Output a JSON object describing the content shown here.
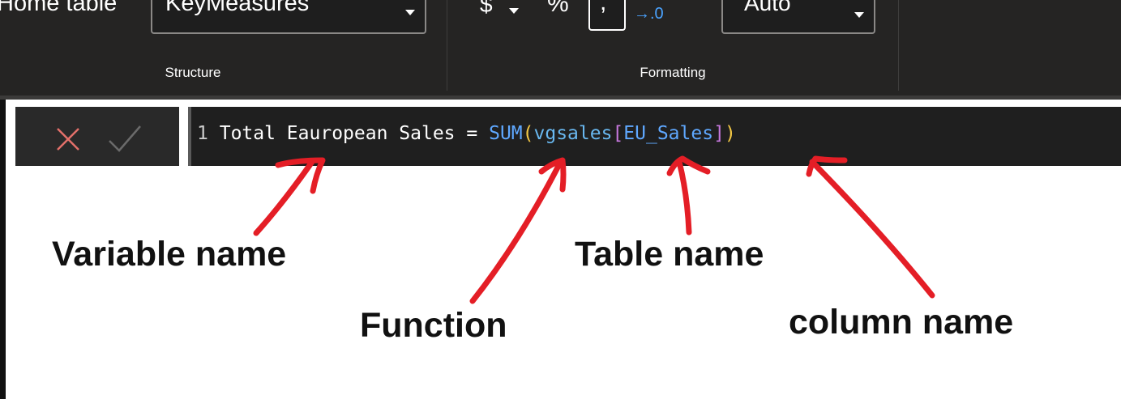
{
  "ribbon": {
    "home_table_label": "Home table",
    "home_table_value": "KeyMeasures",
    "structure_label": "Structure",
    "formatting_label": "Formatting",
    "currency_symbol": "$",
    "percent_symbol": "%",
    "comma_symbol": ",",
    "auto_value": "Auto"
  },
  "formula_bar": {
    "line_number": "1",
    "measure_name": "Total Eauropean Sales",
    "equals": "=",
    "function": "SUM",
    "open_paren": "(",
    "table": "vgsales",
    "open_bracket": "[",
    "column": "EU_Sales",
    "close_bracket": "]",
    "close_paren": ")",
    "cancel_icon": "close-icon",
    "commit_icon": "checkmark-icon"
  },
  "annotations": {
    "variable_name": "Variable name",
    "function": "Function",
    "table_name": "Table name",
    "column_name": "column name"
  },
  "colors": {
    "arrow": "#e41e26",
    "ribbon_bg": "#252423",
    "function_token": "#5fa8ff",
    "paren_token": "#f2c744",
    "bracket_token": "#c678dd"
  }
}
